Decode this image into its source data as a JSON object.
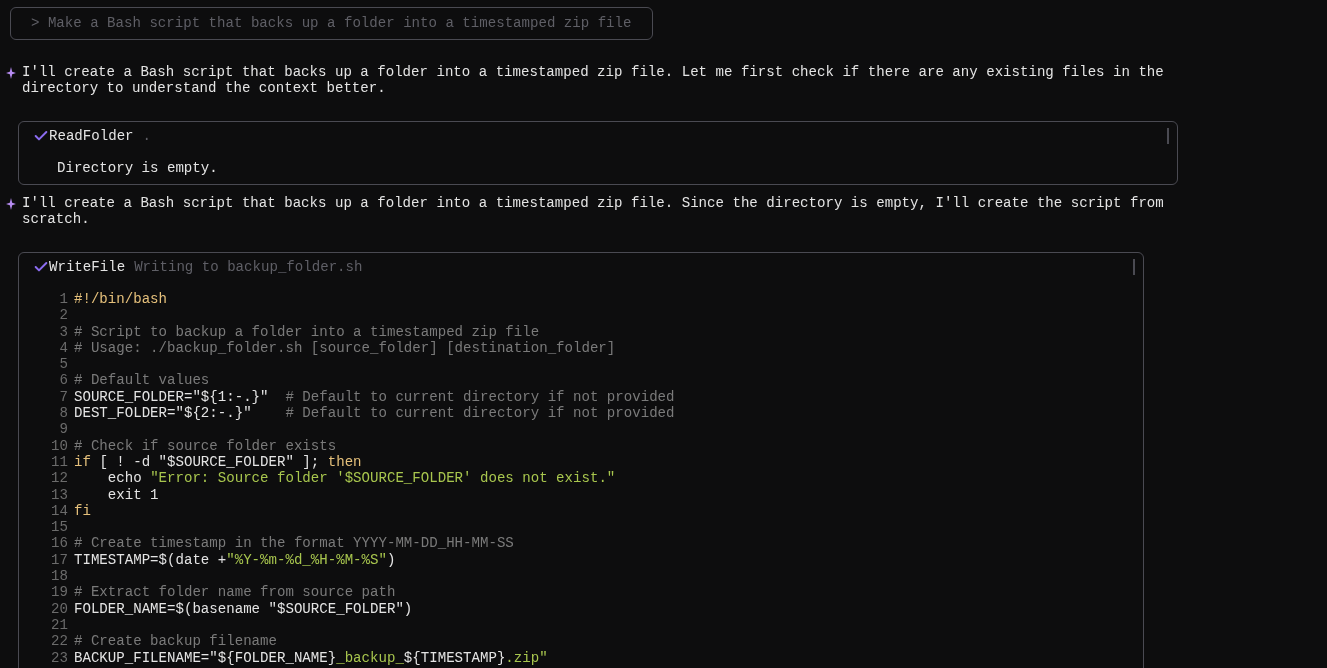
{
  "prompt": {
    "text": "> Make a Bash script that backs up a folder into a timestamped zip file"
  },
  "feed": [
    {
      "kind": "message",
      "text": "I'll create a Bash script that backs up a folder into a timestamped zip file. Let me first check if there are any existing files in the directory to understand the context better."
    },
    {
      "kind": "tool",
      "name": "ReadFolder",
      "detail": ".",
      "done": true,
      "output": "Directory is empty."
    },
    {
      "kind": "message",
      "text": "I'll create a Bash script that backs up a folder into a timestamped zip file. Since the directory is empty, I'll create the script from scratch."
    },
    {
      "kind": "tool",
      "name": "WriteFile",
      "detail": "Writing to backup_folder.sh",
      "done": true,
      "code": [
        {
          "num": "1",
          "parts": [
            {
              "kind": "keyword",
              "text": "#!/bin/bash"
            }
          ]
        },
        {
          "num": "2"
        },
        {
          "num": "3",
          "parts": [
            {
              "kind": "comment",
              "text": "# Script to backup a folder into a timestamped zip file"
            }
          ]
        },
        {
          "num": "4",
          "parts": [
            {
              "kind": "comment",
              "text": "# Usage: ./backup_folder.sh [source_folder] [destination_folder]"
            }
          ]
        },
        {
          "num": "5"
        },
        {
          "num": "6",
          "parts": [
            {
              "kind": "comment",
              "text": "# Default values"
            }
          ]
        },
        {
          "num": "7",
          "parts": [
            {
              "kind": "plain",
              "text": "SOURCE_FOLDER=\"${1:-.}\"  "
            },
            {
              "kind": "comment",
              "text": "# Default to current directory if not provided"
            }
          ]
        },
        {
          "num": "8",
          "parts": [
            {
              "kind": "plain",
              "text": "DEST_FOLDER=\"${2:-.}\"    "
            },
            {
              "kind": "comment",
              "text": "# Default to current directory if not provided"
            }
          ]
        },
        {
          "num": "9"
        },
        {
          "num": "10",
          "parts": [
            {
              "kind": "comment",
              "text": "# Check if source folder exists"
            }
          ]
        },
        {
          "num": "11",
          "parts": [
            {
              "kind": "keyword",
              "text": "if"
            },
            {
              "kind": "plain",
              "text": " [ ! -d \"$SOURCE_FOLDER\" ]; "
            },
            {
              "kind": "keyword",
              "text": "then"
            }
          ]
        },
        {
          "num": "12",
          "parts": [
            {
              "kind": "plain",
              "text": "    echo "
            },
            {
              "kind": "string",
              "text": "\"Error: Source folder '$SOURCE_FOLDER' does not exist.\""
            }
          ]
        },
        {
          "num": "13",
          "parts": [
            {
              "kind": "plain",
              "text": "    exit 1"
            }
          ]
        },
        {
          "num": "14",
          "parts": [
            {
              "kind": "keyword",
              "text": "fi"
            }
          ]
        },
        {
          "num": "15"
        },
        {
          "num": "16",
          "parts": [
            {
              "kind": "comment",
              "text": "# Create timestamp in the format YYYY-MM-DD_HH-MM-SS"
            }
          ]
        },
        {
          "num": "17",
          "parts": [
            {
              "kind": "plain",
              "text": "TIMESTAMP=$(date +"
            },
            {
              "kind": "string",
              "text": "\"%Y-%m-%d_%H-%M-%S\""
            },
            {
              "kind": "plain",
              "text": ")"
            }
          ]
        },
        {
          "num": "18"
        },
        {
          "num": "19",
          "parts": [
            {
              "kind": "comment",
              "text": "# Extract folder name from source path"
            }
          ]
        },
        {
          "num": "20",
          "parts": [
            {
              "kind": "plain",
              "text": "FOLDER_NAME=$(basename \"$SOURCE_FOLDER\")"
            }
          ]
        },
        {
          "num": "21"
        },
        {
          "num": "22",
          "parts": [
            {
              "kind": "comment",
              "text": "# Create backup filename"
            }
          ]
        },
        {
          "num": "23",
          "parts": [
            {
              "kind": "plain",
              "text": "BACKUP_FILENAME=\"${FOLDER_NAME}"
            },
            {
              "kind": "string",
              "text": "_backup_"
            },
            {
              "kind": "plain",
              "text": "${TIMESTAMP}"
            },
            {
              "kind": "string",
              "text": ".zip\""
            }
          ]
        }
      ]
    }
  ]
}
